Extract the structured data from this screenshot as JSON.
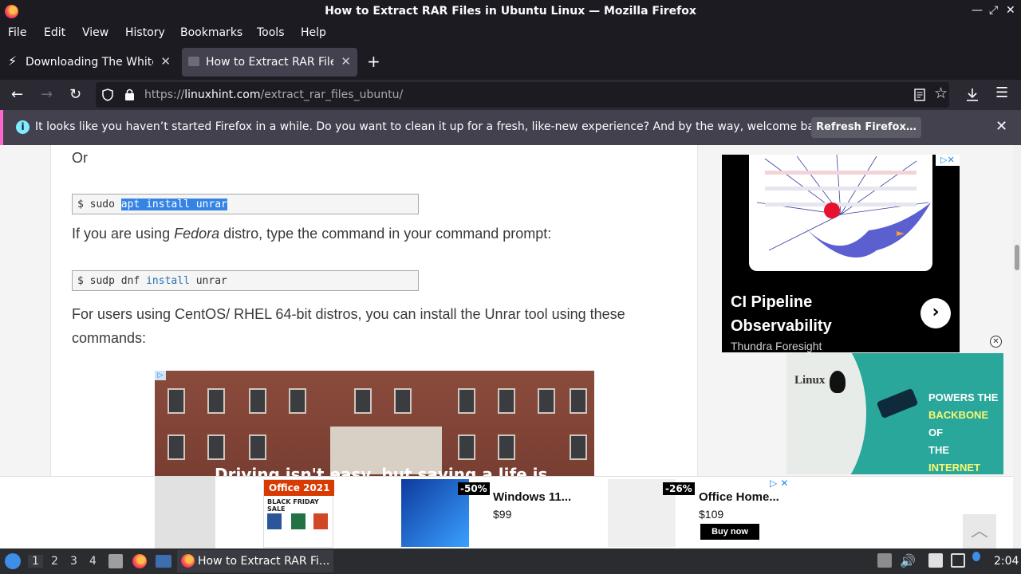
{
  "window": {
    "title": "How to Extract RAR Files in Ubuntu Linux — Mozilla Firefox",
    "controls": [
      "—",
      "⤢",
      "✕"
    ]
  },
  "menu": [
    "File",
    "Edit",
    "View",
    "History",
    "Bookmarks",
    "Tools",
    "Help"
  ],
  "tabs": [
    {
      "label": "Downloading The White Ho",
      "active": false
    },
    {
      "label": "How to Extract RAR Files i",
      "active": true
    }
  ],
  "new_tab": "+",
  "url": {
    "prefix": "https://",
    "domain": "linuxhint.com",
    "path": "/extract_rar_files_ubuntu/"
  },
  "notification": {
    "message": "It looks like you haven’t started Firefox in a while. Do you want to clean it up for a fresh, like-new experience? And by the way, welcome back!",
    "button": "Refresh Firefox…"
  },
  "article": {
    "or": "Or",
    "code1": {
      "prompt": "$ sudo ",
      "selected": "apt install unrar"
    },
    "fedora_pre": "If you are using ",
    "fedora_em": "Fedora",
    "fedora_post": " distro, type the command in your command prompt:",
    "code2": {
      "prompt": "$ sudp dnf ",
      "kw": "install",
      "rest": " unrar"
    },
    "centos": "For users using CentOS/ RHEL 64-bit distros, you can install the Unrar tool using these commands:",
    "video_caption": "Driving isn't easy, but saving a life is"
  },
  "ads": {
    "ad1": {
      "headline": "CI Pipeline Observability",
      "sponsor": "Thundra Foresight",
      "adchoices": "▷✕"
    },
    "ad2": {
      "logo": "Linux",
      "tagline1": "POWERS THE",
      "tagline2": "BACKBONE",
      "tagline3": "OF",
      "tagline4": "THE",
      "tagline5": "INTERNET"
    },
    "bottom": {
      "banner_title": "Office 2021",
      "banner_sub": "BLACK FRIDAY SALE",
      "products": [
        {
          "discount": "-50%",
          "name": "Windows 11...",
          "price": "$99"
        },
        {
          "discount": "-26%",
          "name": "Office Home...",
          "price": "$109",
          "button": "Buy now"
        }
      ]
    }
  },
  "taskbar": {
    "workspaces": [
      "1",
      "2",
      "3",
      "4"
    ],
    "task_label": "How to Extract RAR Fi...",
    "clock": "2:04"
  },
  "colors": {
    "accent": "#3584e4",
    "firefox_dark": "#1c1b22",
    "notif_border": "#ff66cc"
  }
}
